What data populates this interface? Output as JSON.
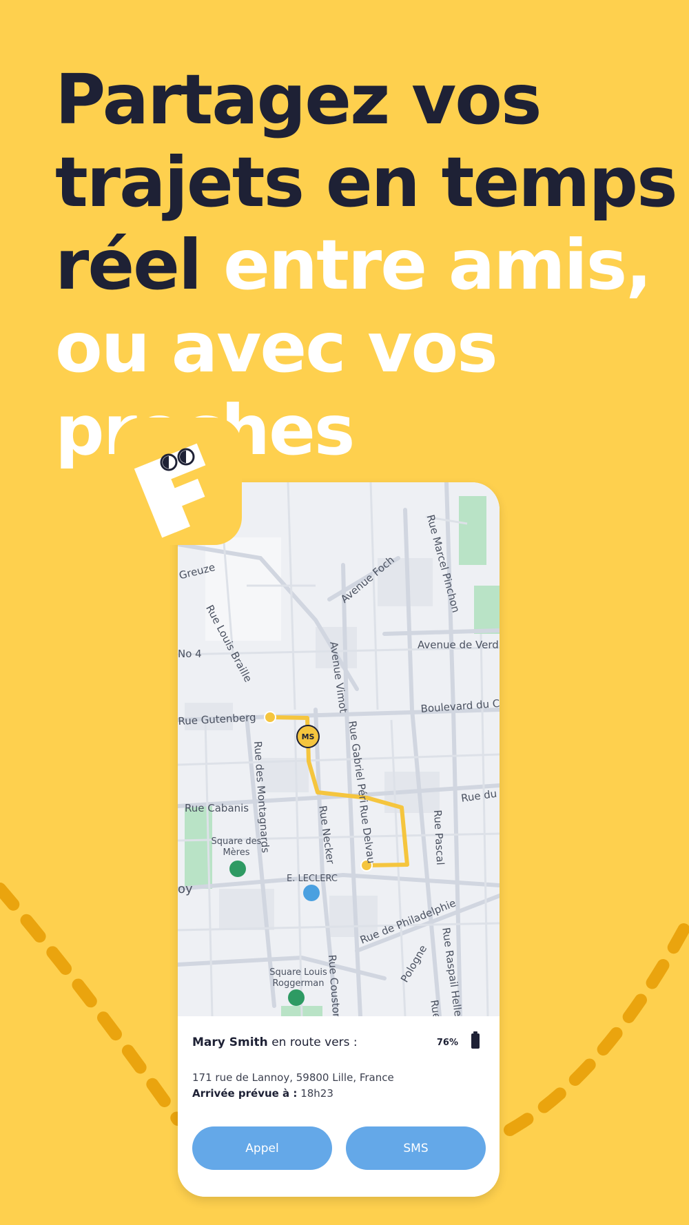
{
  "headline": {
    "dark_text": "Partagez vos trajets en temps réel",
    "light_text": "entre amis, ou avec vos proches"
  },
  "colors": {
    "background": "#FED04E",
    "headline_dark": "#1E2135",
    "headline_light": "#FFFFFF",
    "route": "#F5C53E",
    "button": "#64A8E8"
  },
  "map": {
    "streets": [
      "Greuze",
      "Avenue Foch",
      "Rue Marcel Pinchon",
      "Rue Louis Braille",
      "No 4",
      "Avenue de Verd",
      "Avenue Vimot",
      "Boulevard du C",
      "Rue Gutenberg",
      "Rue Gabriel Péri",
      "Rue des Montagnards",
      "Rue du",
      "Rue Cabanis",
      "Rue Necker",
      "Rue Delvau",
      "Rue Pascal",
      "oy",
      "Rue de Philadelphie",
      "Rue Raspail Helle",
      "Rue Couston",
      "Pologne",
      "Rue"
    ],
    "poi_square_meres": "Square des Mères",
    "poi_leclerc": "E. LECLERC",
    "poi_square_louis": "Square Louis Roggerman",
    "marker_initials": "MS"
  },
  "card": {
    "name": "Mary Smith",
    "status": "en route vers :",
    "battery": "76%",
    "address": "171 rue de Lannoy, 59800 Lille, France",
    "eta_label": "Arrivée prévue à :",
    "eta_time": "18h23",
    "call_label": "Appel",
    "sms_label": "SMS"
  }
}
